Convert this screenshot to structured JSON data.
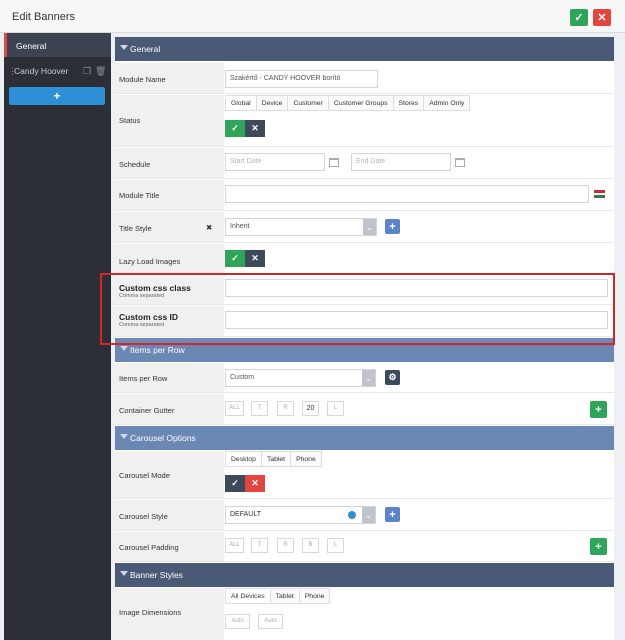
{
  "window": {
    "title": "Edit Banners"
  },
  "sidebar": {
    "items": [
      {
        "label": "General"
      },
      {
        "label": "Candy Hoover"
      }
    ],
    "add_label": "+"
  },
  "sections": {
    "general": "General",
    "items_per_row": "Items per Row",
    "carousel_options": "Carousel Options",
    "banner_styles": "Banner Styles"
  },
  "general": {
    "module_name_label": "Module Name",
    "module_name_value": "Szakértő - CANDY HOOVER borító",
    "status_label": "Status",
    "device_tabs": [
      "Global",
      "Device",
      "Customer",
      "Customer Groups",
      "Stores",
      "Admin Only"
    ],
    "schedule_label": "Schedule",
    "start_date_ph": "Start Date",
    "end_date_ph": "End Date",
    "module_title_label": "Module Title",
    "module_title_value": "",
    "title_style_label": "Title Style",
    "title_style_value": "Inherit",
    "lazy_load_label": "Lazy Load Images",
    "custom_css_class_label": "Custom css class",
    "custom_css_class_hint": "Comma separated",
    "custom_css_id_label": "Custom css ID",
    "custom_css_id_hint": "Comma separated"
  },
  "items_per_row": {
    "label": "Items per Row",
    "value": "Custom",
    "gutter_label": "Container Gutter",
    "gutter_fields": [
      "ALL",
      "T",
      "R",
      "20",
      "L"
    ]
  },
  "carousel": {
    "mode_label": "Carousel Mode",
    "tabs": [
      "Desktop",
      "Tablet",
      "Phone"
    ],
    "style_label": "Carousel Style",
    "style_value": "DEFAULT",
    "padding_label": "Carousel Padding",
    "padding_fields": [
      "ALL",
      "T",
      "R",
      "B",
      "L"
    ]
  },
  "banner": {
    "dims_label": "Image Dimensions",
    "tabs": [
      "All Devices",
      "Tablet",
      "Phone"
    ],
    "dims_fields": [
      "Auto",
      "Auto"
    ]
  },
  "icons": {
    "ok": "✓",
    "close": "✕",
    "check": "✓",
    "x": "✕",
    "plus": "+",
    "gear": "⚙",
    "chev": "⌄"
  },
  "colors": {
    "accent_green": "#2fa55a",
    "accent_red": "#e3463e",
    "section_dark": "#4a5a76",
    "section_light": "#6b87b3",
    "highlight": "#d9232a"
  }
}
